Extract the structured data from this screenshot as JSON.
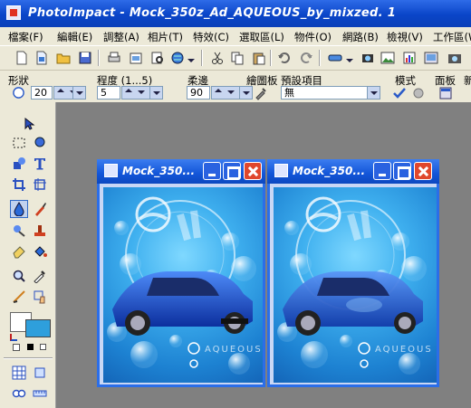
{
  "app": {
    "title": "PhotoImpact - Mock_350z_Ad_AQUEOUS_by_mixzed. 1"
  },
  "menu": [
    "檔案(F)",
    "編輯(E)",
    "調整(A)",
    "相片(T)",
    "特效(C)",
    "選取區(L)",
    "物件(O)",
    "網路(B)",
    "檢視(V)",
    "工作區(W"
  ],
  "toolbar_icons": [
    "new-icon",
    "open-icon",
    "folder-icon",
    "save-icon",
    "print-icon",
    "scan-icon",
    "preview-icon",
    "web-icon",
    "cut-icon",
    "copy-icon",
    "paste-icon",
    "undo-icon",
    "redo-icon",
    "display-icon",
    "capture-icon",
    "gallery-icon",
    "chart-icon",
    "explorer-icon",
    "camera-icon"
  ],
  "attributes": {
    "shape_label": "形狀",
    "shape_value": "20",
    "level_label": "程度 (1...5)",
    "level_value": "5",
    "soft_edge_label": "柔邊",
    "soft_edge_value": "90",
    "draw_board_label": "繪圖板",
    "preset_label": "預設項目",
    "preset_value": "無",
    "mode_label": "模式",
    "panel_label": "面板",
    "extra_label": "新"
  },
  "tools": [
    "pick-tool-icon",
    "transform-icon",
    "selection-icon",
    "lasso-icon",
    "path-icon",
    "text-icon",
    "crop-icon",
    "perspective-icon",
    "smudge-icon",
    "paint-icon",
    "clone-icon",
    "stamp-icon",
    "eraser-icon",
    "fill-icon",
    "zoom-icon",
    "eyedropper-icon",
    "line-icon",
    "hand-icon",
    "grid-icon",
    "frame-icon",
    "view-icon",
    "ruler-icon"
  ],
  "colors": {
    "foreground": "#ffffff",
    "background": "#2e9fdc",
    "titlebar": "#0a45c8",
    "workspace": "#808080"
  },
  "documents": [
    {
      "name": "Mock_350...",
      "art_text": "AQUEOUS"
    },
    {
      "name": "Mock_350...",
      "art_text": "AQUEOUS"
    }
  ]
}
